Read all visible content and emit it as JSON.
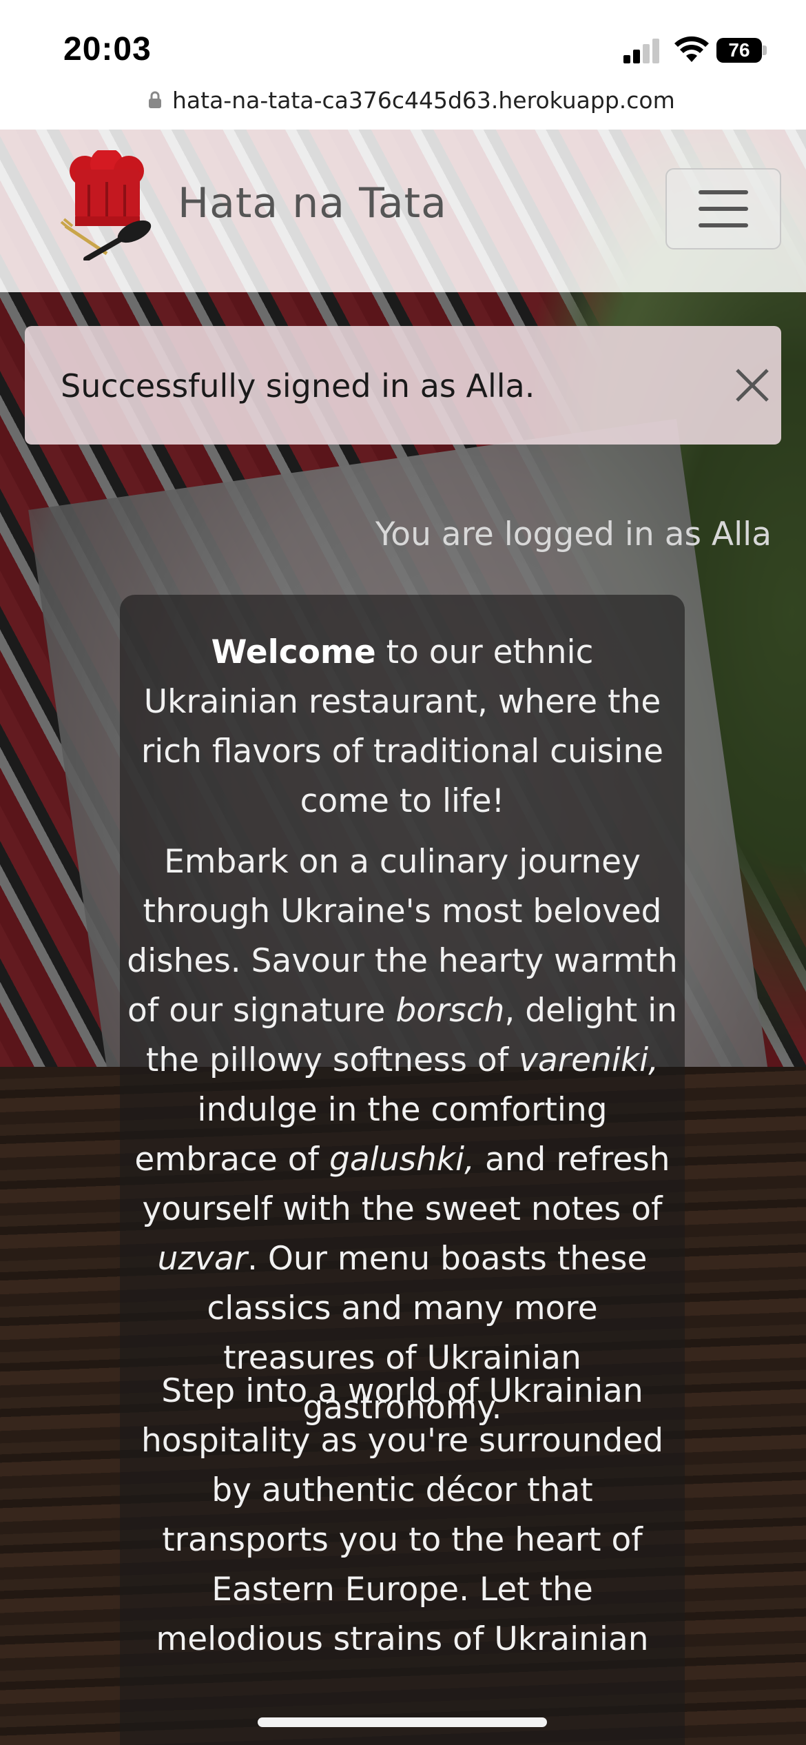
{
  "status_bar": {
    "time": "20:03",
    "battery": "76"
  },
  "browser": {
    "url": "hata-na-tata-ca376c445d63.herokuapp.com"
  },
  "navbar": {
    "brand": "Hata na Tata"
  },
  "alert": {
    "message": "Successfully signed in as Alla."
  },
  "user_status": "You are logged in as Alla",
  "welcome": {
    "p1_lead": "Welcome",
    "p1_rest": " to our ethnic Ukrainian restaurant, where the rich flavors of traditional cuisine come to life!",
    "p2_a": "Embark on a culinary journey through Ukraine's most beloved dishes. Savour the hearty warmth of our signature ",
    "p2_borsch": "borsch",
    "p2_b": ", delight in the pillowy softness of ",
    "p2_vareniki": "vareniki,",
    "p2_c": " indulge in the comforting embrace of ",
    "p2_galushki": "galushki,",
    "p2_d": " and refresh yourself with the sweet notes of ",
    "p2_uzvar": "uzvar",
    "p2_e": ". Our menu boasts these classics and many more treasures of Ukrainian gastronomy.",
    "p3": "Step into a world of Ukrainian hospitality as you're surrounded by authentic décor that transports you to the heart of Eastern Europe. Let the melodious strains of Ukrainian"
  }
}
